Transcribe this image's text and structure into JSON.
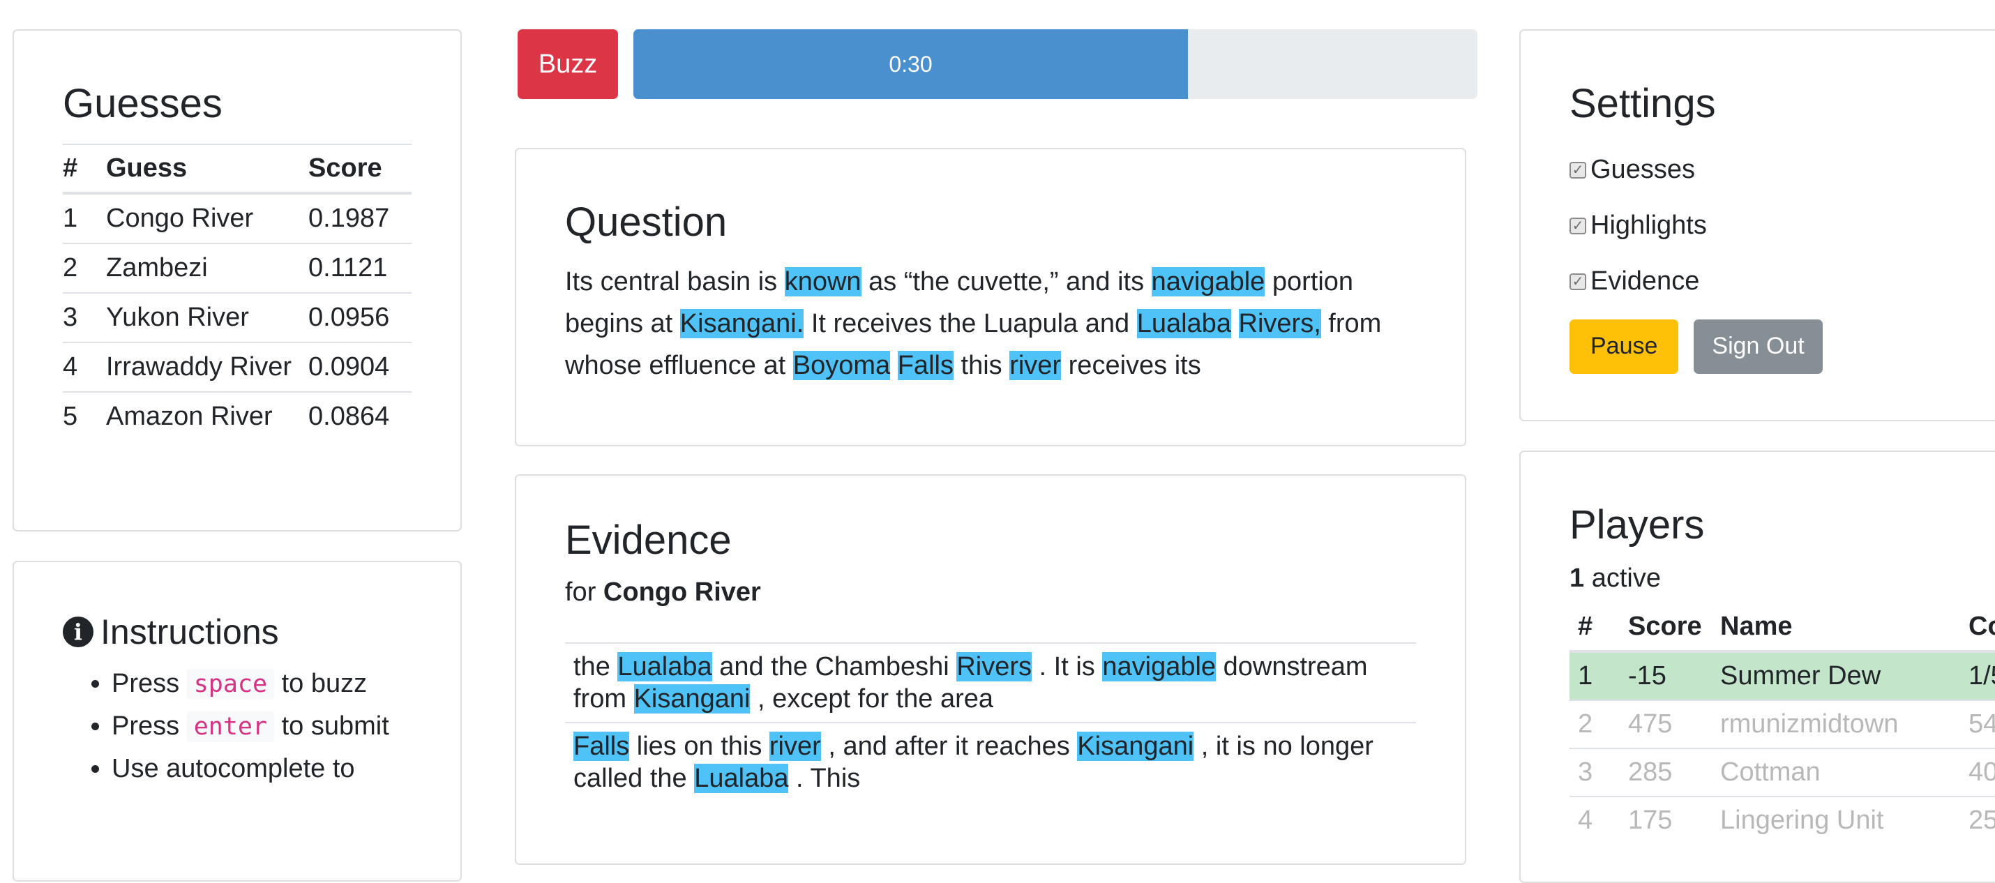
{
  "guesses": {
    "title": "Guesses",
    "headers": {
      "num": "#",
      "guess": "Guess",
      "score": "Score"
    },
    "rows": [
      {
        "num": "1",
        "guess": "Congo River",
        "score": "0.1987"
      },
      {
        "num": "2",
        "guess": "Zambezi",
        "score": "0.1121"
      },
      {
        "num": "3",
        "guess": "Yukon River",
        "score": "0.0956"
      },
      {
        "num": "4",
        "guess": "Irrawaddy River",
        "score": "0.0904"
      },
      {
        "num": "5",
        "guess": "Amazon River",
        "score": "0.0864"
      }
    ]
  },
  "instructions": {
    "title": "Instructions",
    "icon": "info-circle-icon",
    "items": [
      {
        "pre": "Press",
        "key": "space",
        "post": "to buzz"
      },
      {
        "pre": "Press",
        "key": "enter",
        "post": "to submit"
      },
      {
        "pre": "Use autocomplete to",
        "key": "",
        "post": ""
      }
    ]
  },
  "buzz": {
    "label": "Buzz"
  },
  "timer": {
    "label": "0:30",
    "progress_fraction": 0.657
  },
  "question": {
    "title": "Question",
    "segments": [
      {
        "t": "Its central basin is ",
        "hl": false
      },
      {
        "t": "known",
        "hl": true
      },
      {
        "t": " as “the cuvette,” and its ",
        "hl": false
      },
      {
        "t": "navigable",
        "hl": true
      },
      {
        "t": " portion begins at ",
        "hl": false
      },
      {
        "t": "Kisangani.",
        "hl": true
      },
      {
        "t": " It receives the Luapula and ",
        "hl": false
      },
      {
        "t": "Lualaba",
        "hl": true
      },
      {
        "t": " ",
        "hl": false
      },
      {
        "t": "Rivers,",
        "hl": true
      },
      {
        "t": " from whose effluence at ",
        "hl": false
      },
      {
        "t": "Boyoma",
        "hl": true
      },
      {
        "t": " ",
        "hl": false
      },
      {
        "t": "Falls",
        "hl": true
      },
      {
        "t": " this ",
        "hl": false
      },
      {
        "t": "river",
        "hl": true
      },
      {
        "t": " receives its",
        "hl": false
      }
    ]
  },
  "evidence": {
    "title": "Evidence",
    "for_prefix": "for",
    "for_answer": "Congo River",
    "items": [
      [
        {
          "t": "the ",
          "hl": false
        },
        {
          "t": "Lualaba",
          "hl": true
        },
        {
          "t": " and the Chambeshi ",
          "hl": false
        },
        {
          "t": "Rivers",
          "hl": true
        },
        {
          "t": " . It is ",
          "hl": false
        },
        {
          "t": "navigable",
          "hl": true
        },
        {
          "t": " downstream from ",
          "hl": false
        },
        {
          "t": "Kisangani",
          "hl": true
        },
        {
          "t": " , except for the area",
          "hl": false
        }
      ],
      [
        {
          "t": "Falls",
          "hl": true
        },
        {
          "t": " lies on this ",
          "hl": false
        },
        {
          "t": "river",
          "hl": true
        },
        {
          "t": " , and after it reaches ",
          "hl": false
        },
        {
          "t": "Kisangani",
          "hl": true
        },
        {
          "t": " , it is no longer called the ",
          "hl": false
        },
        {
          "t": "Lualaba",
          "hl": true
        },
        {
          "t": " . This",
          "hl": false
        }
      ]
    ]
  },
  "settings": {
    "title": "Settings",
    "options": [
      {
        "label": "Guesses",
        "checked": true
      },
      {
        "label": "Highlights",
        "checked": true
      },
      {
        "label": "Evidence",
        "checked": true
      }
    ],
    "pause_label": "Pause",
    "signout_label": "Sign Out"
  },
  "players": {
    "title": "Players",
    "active_count": "1",
    "active_label": "active",
    "headers": {
      "num": "#",
      "score": "Score",
      "name": "Name",
      "extra": "Co"
    },
    "rows": [
      {
        "num": "1",
        "score": "-15",
        "name": "Summer Dew",
        "extra": "1/5",
        "active": true
      },
      {
        "num": "2",
        "score": "475",
        "name": "rmunizmidtown",
        "extra": "54",
        "active": false
      },
      {
        "num": "3",
        "score": "285",
        "name": "Cottman",
        "extra": "40",
        "active": false
      },
      {
        "num": "4",
        "score": "175",
        "name": "Lingering Unit",
        "extra": "25",
        "active": false
      }
    ]
  },
  "colors": {
    "highlight": "#4fc3f7",
    "buzz": "#dc3545",
    "timer_fill": "#4a8fce",
    "pause": "#ffc107",
    "signout": "#868e96",
    "active_row": "#c3e6cb"
  }
}
